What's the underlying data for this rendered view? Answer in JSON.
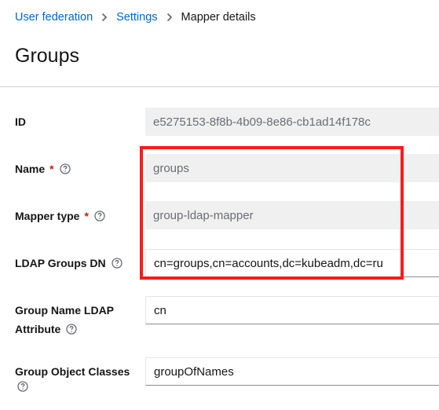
{
  "breadcrumb": {
    "items": [
      "User federation",
      "Settings"
    ],
    "current": "Mapper details"
  },
  "page": {
    "title": "Groups"
  },
  "form": {
    "id": {
      "label": "ID",
      "value": "e5275153-8f8b-4b09-8e86-cb1ad14f178c"
    },
    "name": {
      "label": "Name",
      "required": "*",
      "value": "groups"
    },
    "mapper_type": {
      "label": "Mapper type",
      "required": "*",
      "value": "group-ldap-mapper"
    },
    "ldap_groups_dn": {
      "label": "LDAP Groups DN",
      "value": "cn=groups,cn=accounts,dc=kubeadm,dc=ru"
    },
    "group_name_attr": {
      "label_line1": "Group Name LDAP",
      "label_line2": "Attribute",
      "value": "cn"
    },
    "group_object_classes": {
      "label": "Group Object Classes",
      "value": "groupOfNames"
    }
  },
  "icons": {
    "separator": "chevron-right-icon",
    "help": "question-circle-icon"
  },
  "colors": {
    "link": "#0066cc",
    "required": "#c9190b",
    "highlight": "#ff1a1a",
    "readonly_bg": "#f0f0f0"
  }
}
